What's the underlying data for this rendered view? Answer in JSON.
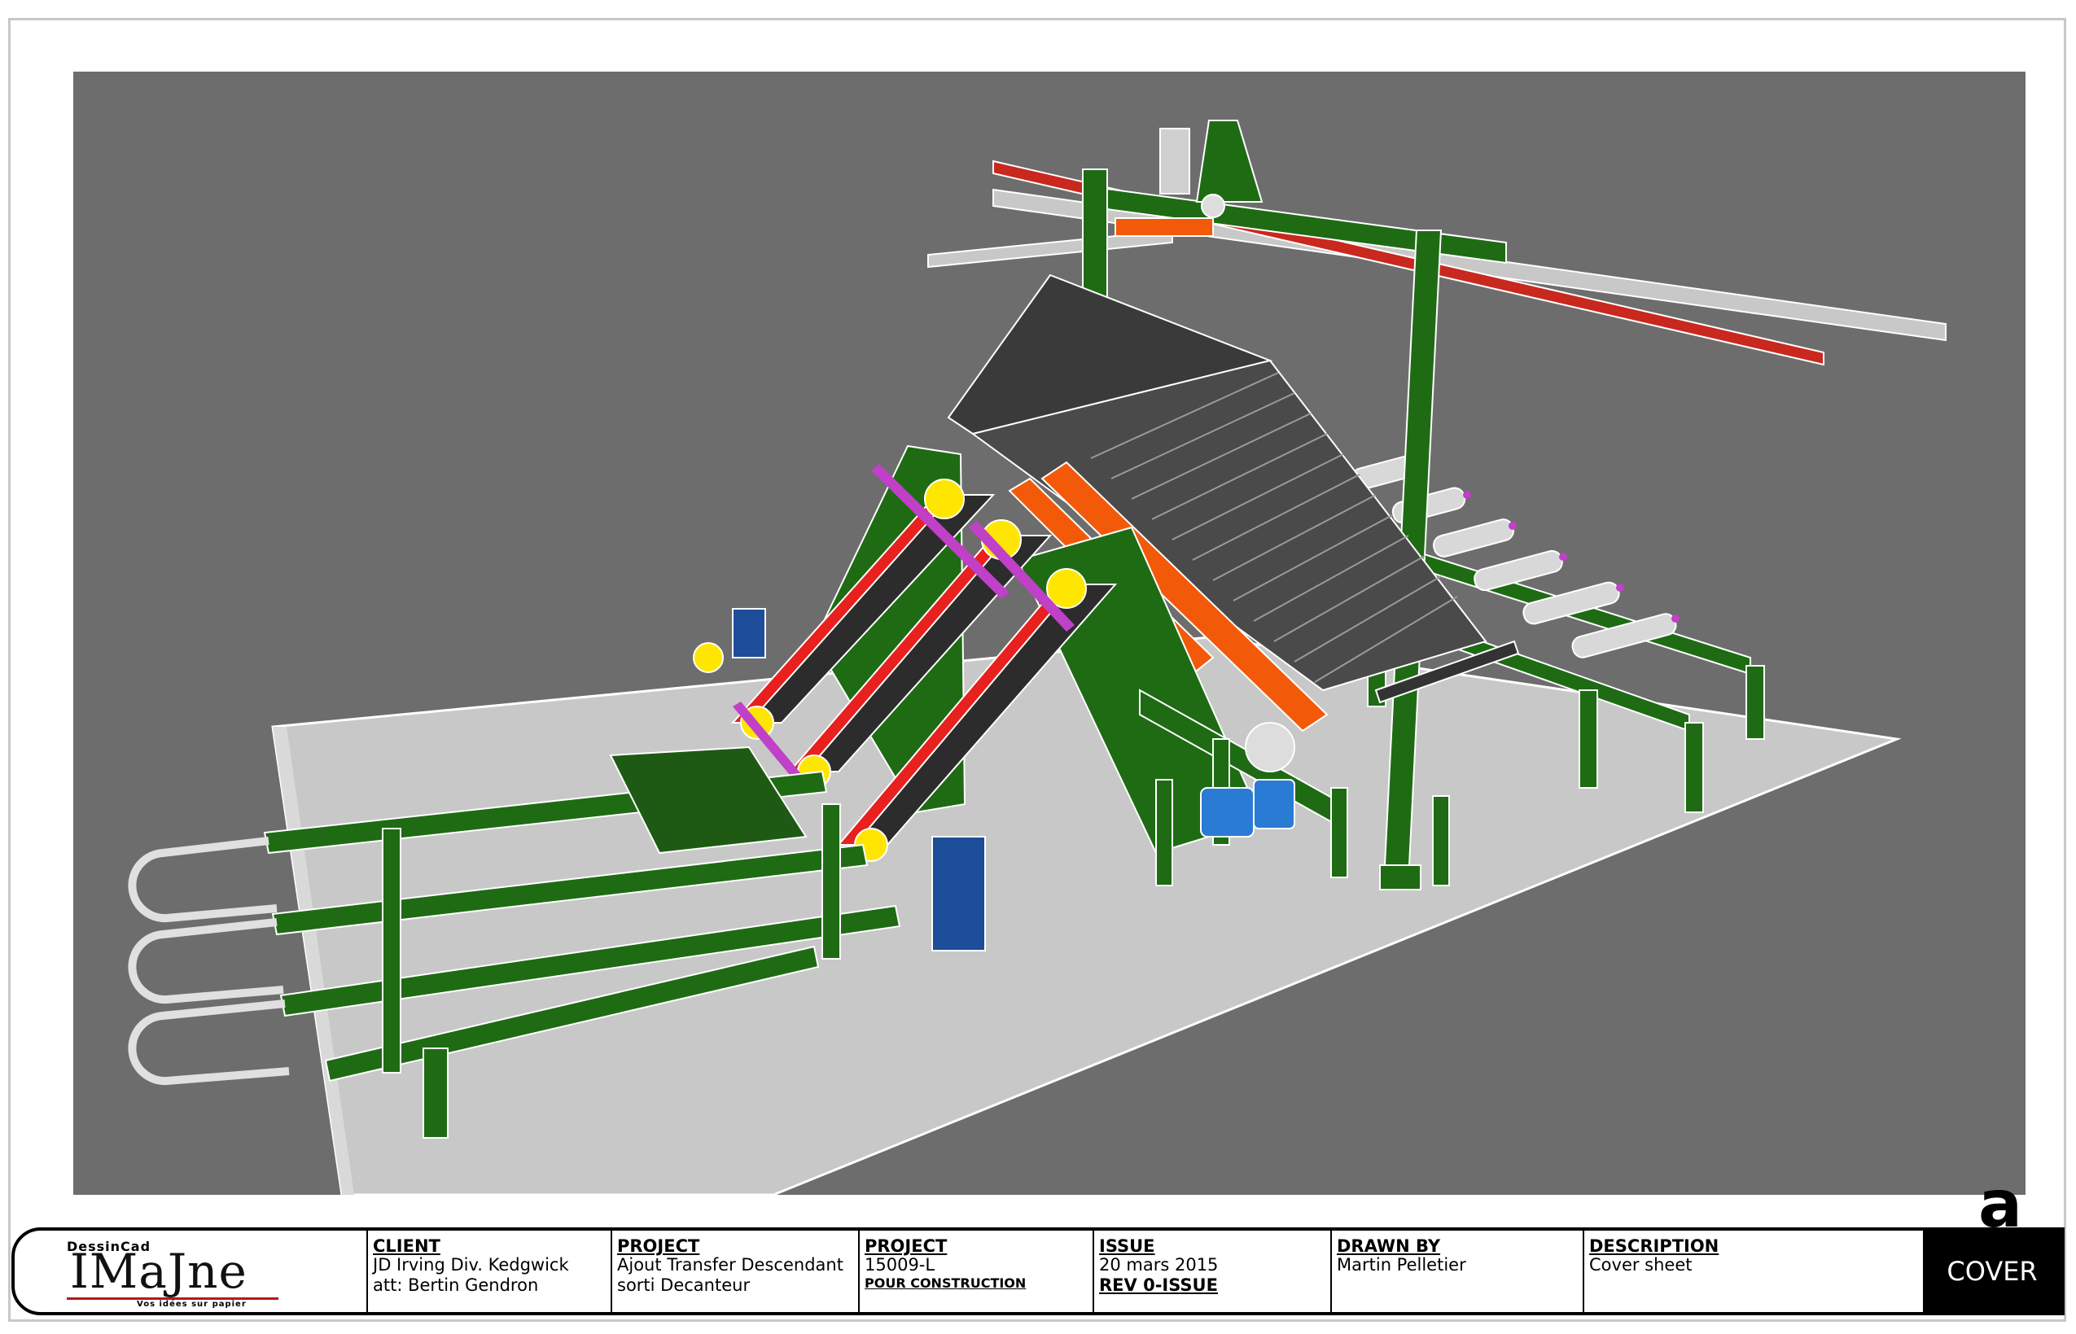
{
  "title_block": {
    "logo": {
      "top_text": "DessinCad",
      "name": "IMaJne",
      "tagline": "Vos idées sur papier"
    },
    "client": {
      "label": "CLIENT",
      "line1": "JD Irving Div. Kedgwick",
      "line2": "att: Bertin Gendron"
    },
    "project": {
      "label": "PROJECT",
      "line1": "Ajout Transfer Descendant",
      "line2": "sorti Decanteur"
    },
    "project_number": {
      "label": "PROJECT",
      "number": "15009-L",
      "status": "POUR CONSTRUCTION"
    },
    "issue": {
      "label": "ISSUE",
      "date": "20 mars 2015",
      "revision": "REV 0-ISSUE"
    },
    "drawn_by": {
      "label": "DRAWN BY",
      "name": "Martin Pelletier"
    },
    "description": {
      "label": "DESCRIPTION",
      "text": "Cover sheet"
    },
    "sheet": {
      "label": "COVER"
    }
  },
  "corner_mark": "a",
  "colors": {
    "background": "#6d6d6d",
    "floor": "#c8c8c8",
    "frame_green": "#1e6b14",
    "belt_red": "#e8201e",
    "orange": "#f25a0a",
    "stack": "#3a3a3a",
    "motor_blue": "#2a7bd4",
    "magenta": "#c040c8"
  }
}
